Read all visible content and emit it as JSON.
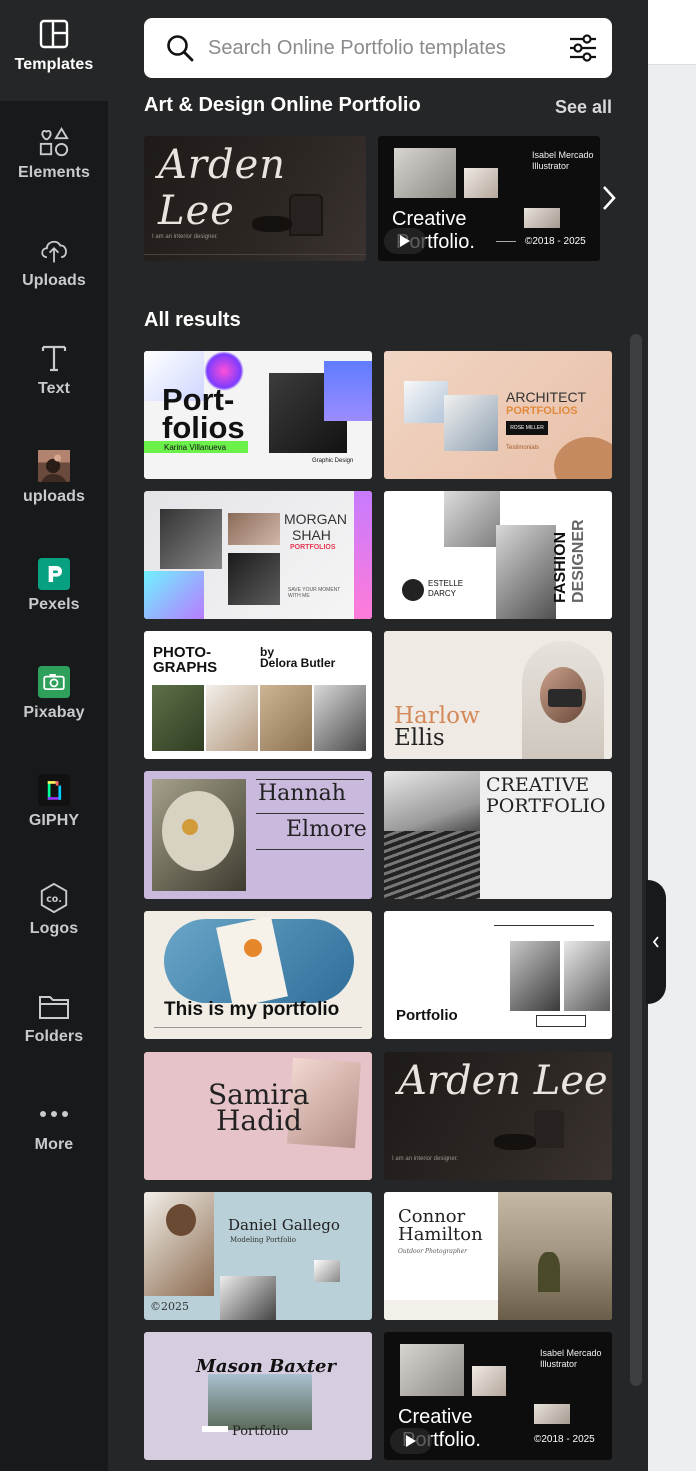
{
  "rail": {
    "items": [
      {
        "label": "Templates",
        "icon": "templates-icon"
      },
      {
        "label": "Elements",
        "icon": "elements-icon"
      },
      {
        "label": "Uploads",
        "icon": "upload-cloud-icon"
      },
      {
        "label": "Text",
        "icon": "text-icon"
      },
      {
        "label": "uploads",
        "icon": "user-photo-icon"
      },
      {
        "label": "Pexels",
        "icon": "pexels-icon"
      },
      {
        "label": "Pixabay",
        "icon": "pixabay-icon"
      },
      {
        "label": "GIPHY",
        "icon": "giphy-icon"
      },
      {
        "label": "Logos",
        "icon": "logos-icon"
      },
      {
        "label": "Folders",
        "icon": "folder-icon"
      },
      {
        "label": "More",
        "icon": "more-dots-icon"
      }
    ]
  },
  "search": {
    "placeholder": "Search Online Portfolio templates"
  },
  "featured": {
    "title": "Art & Design Online Portfolio",
    "see_all": "See all",
    "cards": [
      {
        "headline": "Arden Lee",
        "sub": "I am an interior designer."
      },
      {
        "headline1": "Creative",
        "headline2": "Portfolio.",
        "name": "Isabel Mercado",
        "role": "Illustrator",
        "years": "©2018 - 2025"
      }
    ]
  },
  "results": {
    "title": "All results",
    "cards": [
      {
        "l1": "Port-",
        "l2": "folios",
        "tag": "Karina Villanueva",
        "tag2": "Graphic Design"
      },
      {
        "l1": "ARCHITECT",
        "l2": "PORTFOLIOS",
        "btn": "ROSE MILLER",
        "tag": "Testimonials"
      },
      {
        "l1": "MORGAN",
        "l2": "SHAH",
        "l3": "PORTFOLIOS",
        "tag": "SAVE YOUR MOMENT WITH ME"
      },
      {
        "l1": "FASHION",
        "l2": "DESIGNER",
        "n1": "ESTELLE",
        "n2": "DARCY"
      },
      {
        "l1": "PHOTO-",
        "l2": "GRAPHS",
        "by": "by",
        "name": "Delora Butler"
      },
      {
        "l1": "Harlow",
        "l2": "Ellis"
      },
      {
        "l1": "Hannah",
        "l2": "Elmore"
      },
      {
        "l1": "CREATIVE",
        "l2": "PORTFOLIO"
      },
      {
        "l1": "This is my portfolio"
      },
      {
        "l1": "Portfolio"
      },
      {
        "l1": "Samira",
        "l2": "Hadid"
      },
      {
        "l1": "Arden Lee",
        "sub": "I am an interior designer."
      },
      {
        "l1": "Daniel Gallego",
        "l2": "Modeling Portfolio",
        "year": "©2025"
      },
      {
        "l1": "Connor",
        "l2": "Hamilton",
        "l3": "Outdoor Photographer"
      },
      {
        "l1": "Mason Baxter",
        "l2": "Portfolio"
      },
      {
        "l1": "Creative",
        "l2": "Portfolio.",
        "name": "Isabel Mercado",
        "role": "Illustrator",
        "years": "©2018 - 2025"
      }
    ]
  }
}
